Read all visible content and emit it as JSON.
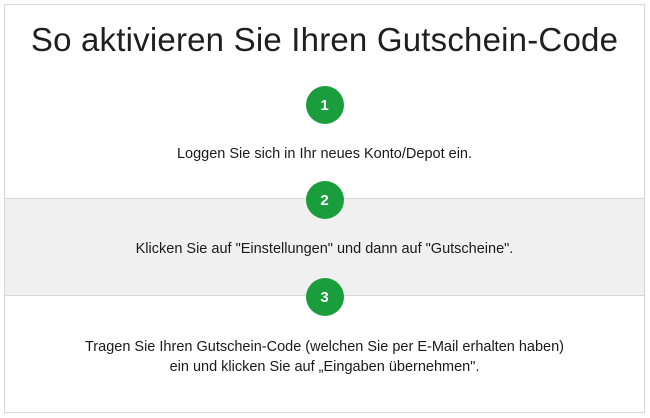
{
  "heading": "So aktivieren Sie Ihren Gutschein-Code",
  "accent_color": "#1a9d3c",
  "steps": [
    {
      "number": "1",
      "text": "Loggen Sie sich in Ihr neues Konto/Depot ein."
    },
    {
      "number": "2",
      "text": "Klicken Sie auf \"Einstellungen\" und dann auf \"Gutscheine\"."
    },
    {
      "number": "3",
      "text_line_1": "Tragen Sie Ihren Gutschein-Code (welchen Sie per E-Mail erhalten haben)",
      "text_line_2": "ein und klicken Sie auf „Eingaben übernehmen\"."
    }
  ]
}
